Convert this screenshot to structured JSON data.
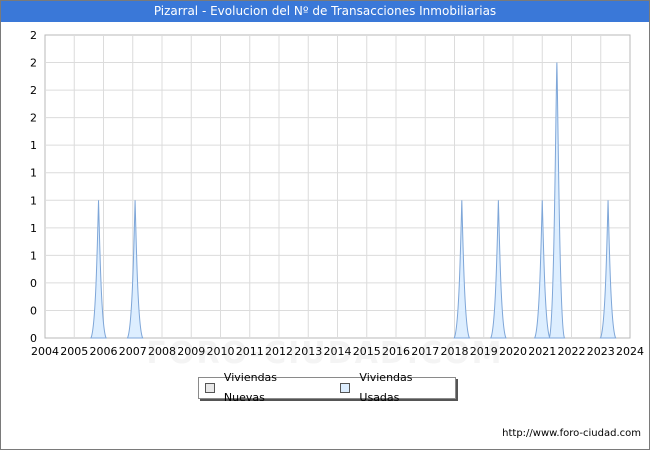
{
  "title": "Pizarral - Evolucion del Nº de Transacciones Inmobiliarias",
  "watermark": "FORO-CIUDAD.COM",
  "source_url": "http://www.foro-ciudad.com",
  "colors": {
    "title_bg": "#3a78d8",
    "nuevas_fill": "#e8e8e8",
    "usadas_fill": "#ddeeff",
    "usadas_stroke": "#7ea6d8",
    "grid": "#dcdcdc"
  },
  "chart_data": {
    "type": "area",
    "title": "Pizarral - Evolucion del Nº de Transacciones Inmobiliarias",
    "xlabel": "",
    "ylabel": "",
    "xlim": [
      2004,
      2024
    ],
    "ylim": [
      0,
      2.2
    ],
    "grid": true,
    "legend_position": "bottom",
    "x_ticks": [
      "2004",
      "2005",
      "2006",
      "2007",
      "2008",
      "2009",
      "2010",
      "2011",
      "2012",
      "2013",
      "2014",
      "2015",
      "2016",
      "2017",
      "2018",
      "2019",
      "2020",
      "2021",
      "2022",
      "2023",
      "2024"
    ],
    "y_ticks": [
      "0",
      "0",
      "0",
      "1",
      "1",
      "1",
      "1",
      "1",
      "2",
      "2",
      "2",
      "2"
    ],
    "series": [
      {
        "name": "Viviendas Nuevas",
        "points": []
      },
      {
        "name": "Viviendas Usadas",
        "points": [
          {
            "x": 2005.83,
            "y": 1
          },
          {
            "x": 2007.08,
            "y": 1
          },
          {
            "x": 2018.25,
            "y": 1
          },
          {
            "x": 2019.5,
            "y": 1
          },
          {
            "x": 2021.0,
            "y": 1
          },
          {
            "x": 2021.5,
            "y": 2
          },
          {
            "x": 2023.25,
            "y": 1
          }
        ]
      }
    ]
  },
  "legend": [
    {
      "label": "Viviendas Nuevas",
      "color": "#e8e8e8"
    },
    {
      "label": "Viviendas Usadas",
      "color": "#ddeeff"
    }
  ]
}
